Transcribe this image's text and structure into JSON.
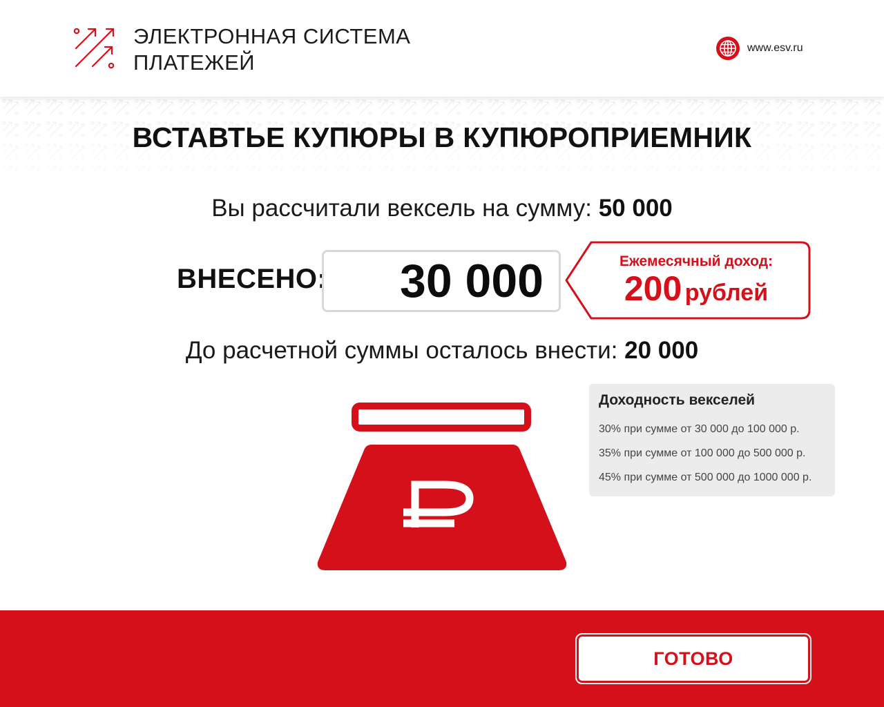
{
  "header": {
    "logo_line1": "ЭЛЕКТРОННАЯ СИСТЕМА",
    "logo_line2": "ПЛАТЕЖЕЙ",
    "website": "www.esv.ru",
    "logo_icon": "arrows-up-right-icon",
    "globe_icon": "globe-icon"
  },
  "main": {
    "title": "ВСТАВТЬЕ КУПЮРЫ В КУПЮРОПРИЕМНИК",
    "calculated_label": "Вы рассчитали вексель на сумму:",
    "calculated_amount": "50 000",
    "deposited_label": "ВНЕСЕНО:",
    "deposited_amount": "30 000",
    "remaining_label": "До расчетной суммы осталось внести:",
    "remaining_amount": "20 000"
  },
  "income": {
    "title": "Ежемесячный доход:",
    "amount": "200",
    "unit": "рублей"
  },
  "acceptor": {
    "icon": "bill-acceptor-ruble-icon",
    "symbol": "₽"
  },
  "yield": {
    "title": "Доходность векселей",
    "items": [
      "30% при сумме от 30 000 до 100 000 р.",
      "35% при сумме от 100 000 до 500 000 р.",
      "45% при сумме от 500 000 до 1000 000 р."
    ]
  },
  "footer": {
    "done_label": "ГОТОВО"
  },
  "colors": {
    "brand_red": "#d4101a",
    "text_dark": "#111111",
    "panel_gray": "#ececec"
  }
}
